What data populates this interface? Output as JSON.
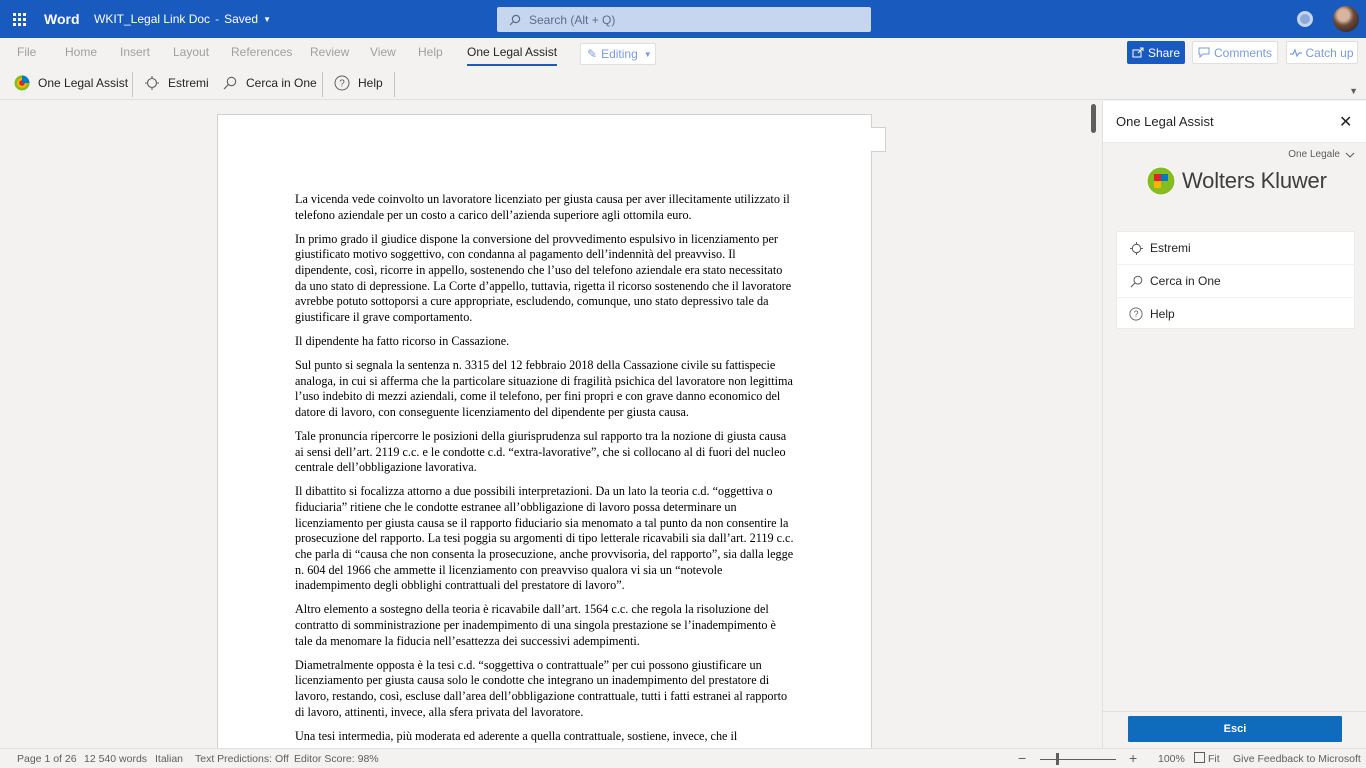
{
  "titlebar": {
    "app_name": "Word",
    "doc_name": "WKIT_Legal Link Doc",
    "separator": "-",
    "save_status": "Saved",
    "search_placeholder": "Search (Alt + Q)"
  },
  "ribbon": {
    "tabs": [
      "File",
      "Home",
      "Insert",
      "Layout",
      "References",
      "Review",
      "View",
      "Help",
      "One Legal Assist"
    ],
    "active_tab": "One Legal Assist",
    "mode": "Editing",
    "share": "Share",
    "comments": "Comments",
    "catch_up": "Catch up"
  },
  "toolbar": {
    "items": [
      "One Legal Assist",
      "Estremi",
      "Cerca in One",
      "Help"
    ]
  },
  "document": {
    "paragraphs": [
      "La vicenda vede coinvolto un lavoratore licenziato per giusta causa per aver illecitamente utilizzato il telefono aziendale per un costo a carico dell’azienda superiore agli ottomila euro.",
      "In primo grado il giudice dispone la conversione del provvedimento espulsivo in licenziamento per giustificato motivo soggettivo, con condanna al pagamento dell’indennità del preavviso. Il dipendente, così, ricorre in appello, sostenendo che l’uso del telefono aziendale era stato necessitato da uno stato di depressione. La Corte d’appello, tuttavia, rigetta il ricorso sostenendo che il lavoratore avrebbe potuto sottoporsi a cure appropriate, escludendo, comunque, uno stato depressivo tale da giustificare il grave comportamento.",
      "Il dipendente ha fatto ricorso in Cassazione.",
      "Sul punto si segnala la sentenza n. 3315 del 12 febbraio 2018 della Cassazione civile su fattispecie analoga, in cui si afferma che la particolare situazione di fragilità psichica del lavoratore non legittima l’uso indebito di mezzi aziendali, come il telefono, per fini propri e con grave danno economico del datore di lavoro, con conseguente licenziamento del dipendente per giusta causa.",
      "Tale pronuncia ripercorre le posizioni della giurisprudenza sul rapporto tra la nozione di giusta causa ai sensi dell’art. 2119 c.c. e le condotte c.d. “extra-lavorative”, che si collocano al di fuori del nucleo centrale dell’obbligazione lavorativa.",
      "Il dibattito si focalizza attorno a due possibili interpretazioni. Da un lato la teoria c.d. “oggettiva o fiduciaria” ritiene che le condotte estranee all’obbligazione di lavoro possa determinare un licenziamento per giusta causa se il rapporto fiduciario sia menomato a tal punto da non consentire la prosecuzione del rapporto. La tesi poggia su argomenti di tipo letterale ricavabili sia dall’art. 2119 c.c. che parla di “causa che non consenta la prosecuzione, anche provvisoria, del rapporto”, sia dalla legge n. 604 del 1966 che ammette il licenziamento con preavviso qualora vi sia un “notevole inadempimento degli obblighi contrattuali del prestatore di lavoro”.",
      "Altro elemento a sostegno della teoria è ricavabile dall’art. 1564 c.c. che regola la risoluzione del contratto di somministrazione per inadempimento di una singola prestazione se l’inadempimento è tale da menomare la fiducia nell’esattezza dei successivi adempimenti.",
      "Diametralmente opposta è la tesi c.d. “soggettiva o contrattuale” per cui possono giustificare un licenziamento per giusta causa solo le condotte che integrano un inadempimento del prestatore di lavoro, restando, così, escluse dall’area dell’obbligazione contrattuale, tutti i fatti estranei al rapporto di lavoro, attinenti, invece, alla sfera privata del lavoratore.",
      "Una tesi intermedia, più moderata ed aderente a quella contrattuale, sostiene, invece, che il"
    ]
  },
  "panel": {
    "title": "One Legal Assist",
    "dropdown": "One Legale",
    "logo_text": "Wolters Kluwer",
    "menu": [
      "Estremi",
      "Cerca in One",
      "Help"
    ],
    "exit_button": "Esci"
  },
  "statusbar": {
    "page": "Page 1 of 26",
    "words": "12 540 words",
    "language": "Italian",
    "text_predictions": "Text Predictions: Off",
    "editor_score": "Editor Score: 98%",
    "zoom_minus": "−",
    "zoom_plus": "+",
    "zoom": "100%",
    "fit": "Fit",
    "feedback": "Give Feedback to Microsoft"
  },
  "icons": {
    "brand_blue": "#185abd",
    "logo_colors": [
      "#e5202e",
      "#85bc20",
      "#007ac3",
      "#f7b600"
    ]
  }
}
